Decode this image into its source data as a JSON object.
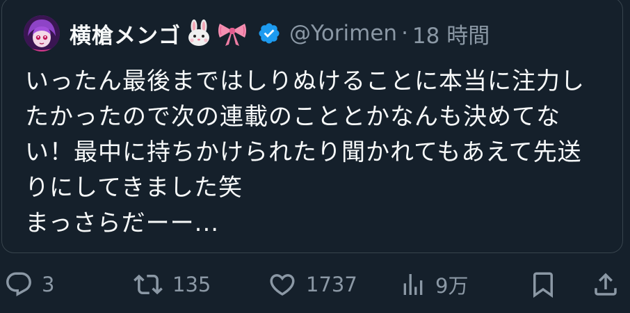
{
  "tweet": {
    "display_name": "横槍メンゴ",
    "name_emoji": [
      "rabbit-face-icon",
      "ribbon-icon"
    ],
    "handle": "@Yorimen",
    "separator": "·",
    "time": "18 時間",
    "body_lines": [
      "いったん最後まではしりぬけることに本当に注力し",
      "たかったので次の連載のこととかなんも決めてな",
      "い！最中に持ちかけられたり聞かれてもあえて先送",
      "りにしてきました笑",
      "まっさらだーー..."
    ]
  },
  "actions": {
    "reply_count": "3",
    "retweet_count": "135",
    "like_count": "1737",
    "views_count": "9万"
  },
  "colors": {
    "background": "#15202b",
    "border": "#38444d",
    "text": "#f7f9f9",
    "muted": "#8b98a5",
    "verified": "#1d9bf0"
  }
}
